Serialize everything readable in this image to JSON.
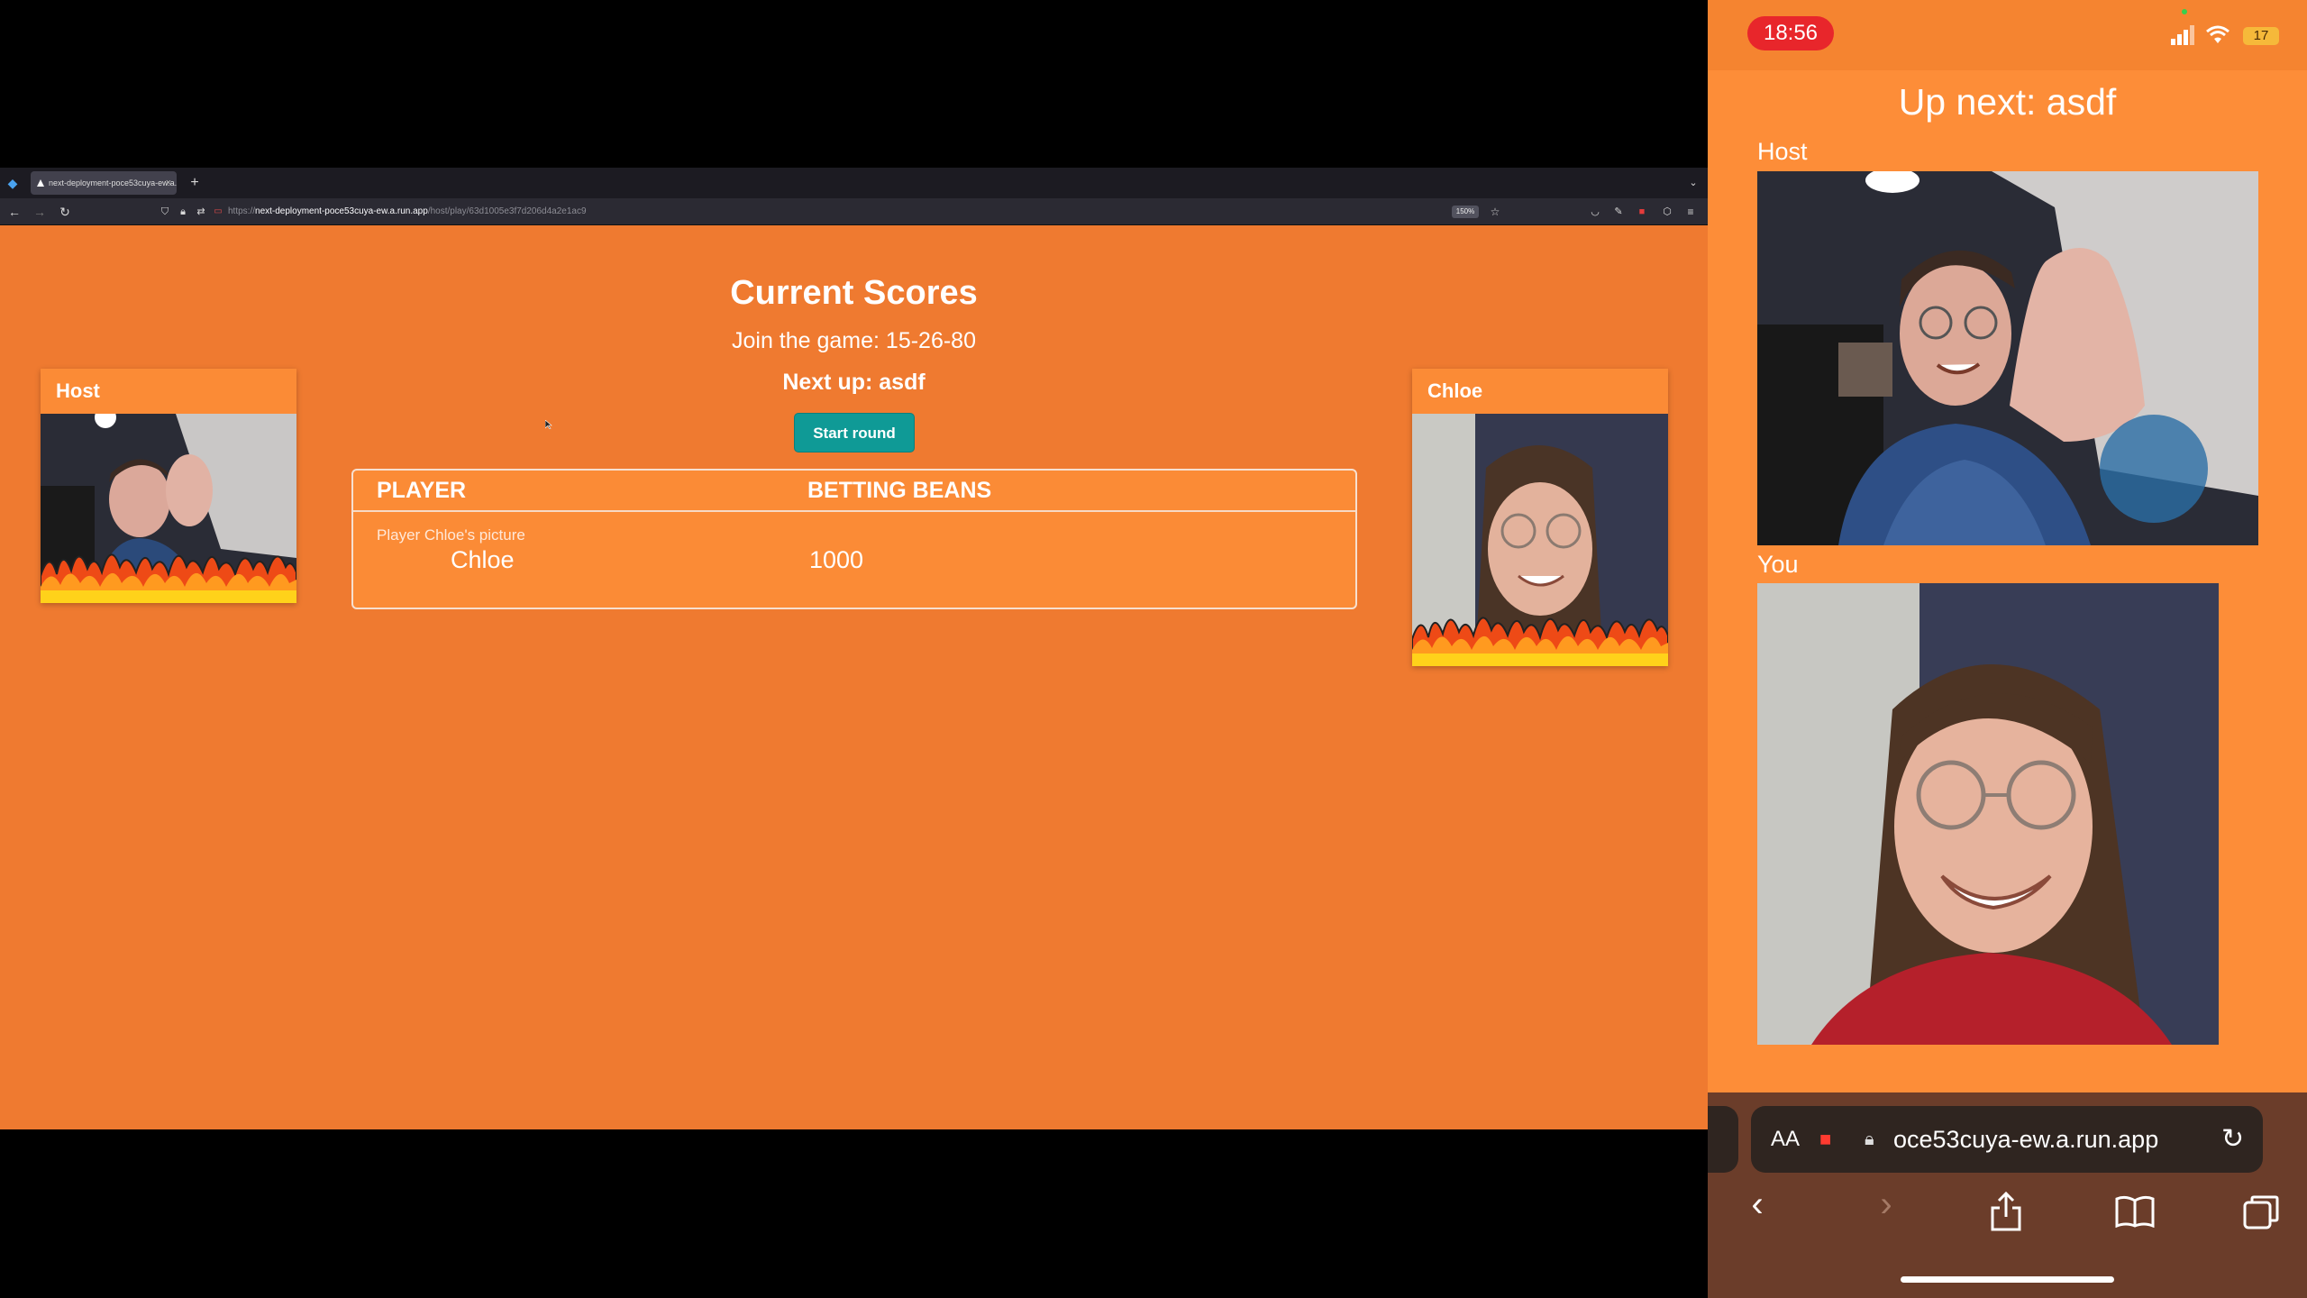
{
  "browser": {
    "tab_title": "next-deployment-poce53cuya-ew.a.run.app",
    "url_prefix": "https://",
    "url_host": "next-deployment-poce53cuya-ew.a.run.app",
    "url_path": "/host/play/63d1005e3f7d206d4a2e1ac9",
    "zoom": "150%",
    "new_tab": "+"
  },
  "page": {
    "title": "Current Scores",
    "join_text": "Join the game: 15-26-80",
    "next_up": "Next up: asdf",
    "start_button": "Start round",
    "table": {
      "headers": [
        "PLAYER",
        "BETTING BEANS"
      ],
      "rows": [
        {
          "picture_alt": "Player Chloe's picture",
          "name": "Chloe",
          "beans": "1000"
        }
      ]
    },
    "cards": {
      "left": "Host",
      "right": "Chloe"
    }
  },
  "phone": {
    "time": "18:56",
    "battery": "17",
    "title": "Up next: asdf",
    "host_label": "Host",
    "you_label": "You",
    "address_text_size": "AA",
    "address_url": "oce53cuya-ew.a.run.app"
  },
  "colors": {
    "page_bg": "#ef7a30",
    "card_bg": "#fb8b36",
    "button": "#0f9a96",
    "phone_bg": "#fd8d38"
  }
}
